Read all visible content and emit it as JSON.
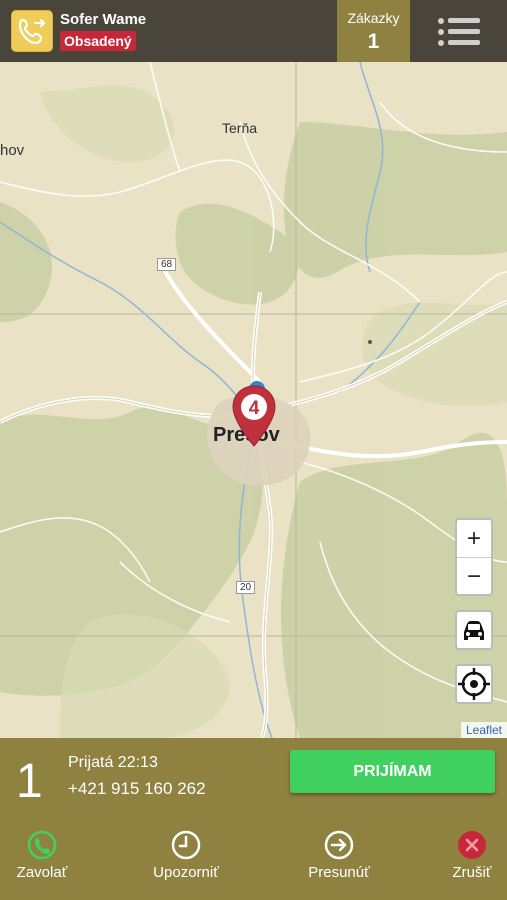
{
  "header": {
    "driver_name": "Sofer Wame",
    "driver_status": "Obsadený",
    "orders_label": "Zákazky",
    "orders_count": "1",
    "menu_icon": "hamburger-icon",
    "driver_icon": "phone-call-icon"
  },
  "map": {
    "places": [
      "Terňa",
      "hov"
    ],
    "city": "Prešov",
    "road_numbers": [
      "68",
      "20"
    ],
    "marker_number": "4",
    "zoom_in": "+",
    "zoom_out": "−",
    "attribution": "Leaflet",
    "car_icon": "car-icon",
    "locate_icon": "crosshair-icon"
  },
  "order": {
    "number": "1",
    "received": "Prijatá 22:13",
    "phone": "+421 915 160 262",
    "accept_label": "PRIJÍMAM"
  },
  "actions": [
    {
      "label": "Zavolať",
      "icon": "phone-icon"
    },
    {
      "label": "Upozorniť",
      "icon": "clock-icon"
    },
    {
      "label": "Presunúť",
      "icon": "arrow-right-circle-icon"
    },
    {
      "label": "Zrušiť",
      "icon": "close-circle-icon"
    }
  ],
  "colors": {
    "accent": "#8f8240",
    "topbar": "#4a453a",
    "status": "#c6283a",
    "accept": "#3fd05f",
    "marker": "#c0313e"
  }
}
